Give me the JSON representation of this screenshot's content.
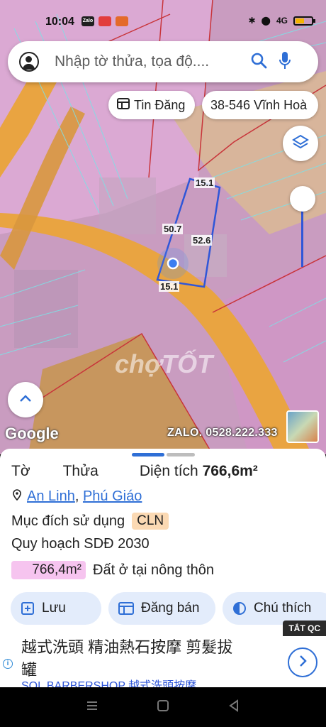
{
  "status_bar": {
    "time": "10:04",
    "apps": [
      "Zalo",
      "",
      ""
    ],
    "network": "4G"
  },
  "search": {
    "placeholder": "Nhập tờ thửa, tọa độ...."
  },
  "chips": {
    "tin_dang": "Tin Đăng",
    "address": "38-546 Vĩnh Hoà"
  },
  "map": {
    "dimensions": {
      "top": "15.1",
      "left": "50.7",
      "right": "52.6",
      "bottom": "15.1"
    },
    "watermark": "chợTỐT",
    "google_logo": "Google",
    "zalo_text": "ZALO. 0528.222.333"
  },
  "sheet": {
    "to_label": "Tờ",
    "thua_label": "Thửa",
    "area_label": "Diện tích",
    "area_value": "766,6m²",
    "location_1": "An Linh",
    "location_sep": ", ",
    "location_2": "Phú Giáo",
    "purpose_label": "Mục đích sử dụng",
    "purpose_code": "CLN",
    "plan_label": "Quy hoạch SDĐ 2030",
    "plan_area": "766,4m²",
    "plan_type": "Đất ở tại nông thôn",
    "actions": {
      "save": "Lưu",
      "post": "Đăng bán",
      "legend": "Chú thích"
    }
  },
  "ad": {
    "close_label": "TẮT QC",
    "line1": "越式洗頭 精油熱石按摩 剪髮拔",
    "line2": "罐",
    "line3": "SOL BARBERSHOP 越式洗頭按摩"
  },
  "colors": {
    "accent": "#2f6fd6",
    "plan_pink": "#f6c4ef",
    "cln_badge": "#fbd9b3",
    "road_orange": "#e9a441"
  }
}
